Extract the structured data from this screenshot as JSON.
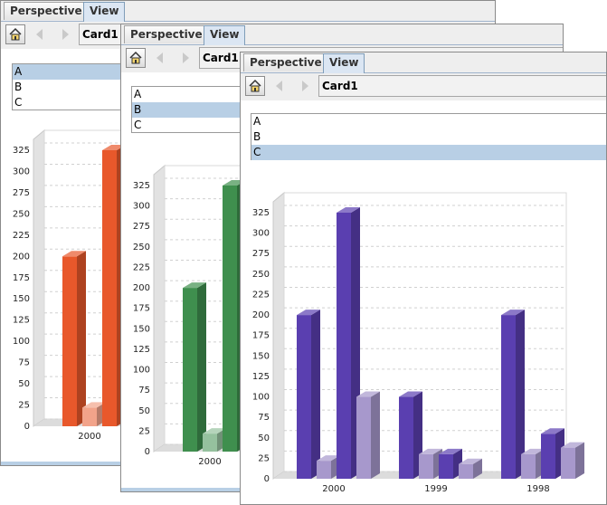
{
  "windows": [
    {
      "id": "w1",
      "tabs": [
        "Perspective",
        "View"
      ],
      "active_tab": 1,
      "toolbar": {
        "home_icon": "home-icon",
        "back_icon": "arrow-left-icon",
        "forward_icon": "arrow-right-icon"
      },
      "card_label": "Card1",
      "list": [
        {
          "label": "A",
          "selected": true
        },
        {
          "label": "B",
          "selected": false
        },
        {
          "label": "C",
          "selected": false
        }
      ],
      "chart_color": "#e8582b",
      "chart_data": {
        "type": "bar",
        "categories": [
          "2000"
        ],
        "series": [
          {
            "values": [
              200
            ]
          },
          {
            "values": [
              22
            ]
          },
          {
            "values": [
              325
            ]
          }
        ],
        "y_ticks": [
          0,
          25,
          50,
          75,
          100,
          125,
          150,
          175,
          200,
          225,
          250,
          275,
          300,
          325
        ],
        "ylim": [
          0,
          325
        ],
        "grid": true
      }
    },
    {
      "id": "w2",
      "tabs": [
        "Perspective",
        "View"
      ],
      "active_tab": 1,
      "toolbar": {
        "home_icon": "home-icon",
        "back_icon": "arrow-left-icon",
        "forward_icon": "arrow-right-icon"
      },
      "card_label": "Card1",
      "list": [
        {
          "label": "A",
          "selected": false
        },
        {
          "label": "B",
          "selected": true
        },
        {
          "label": "C",
          "selected": false
        }
      ],
      "chart_color": "#3f8f4e",
      "chart_data": {
        "type": "bar",
        "categories": [
          "2000"
        ],
        "series": [
          {
            "values": [
              200
            ]
          },
          {
            "values": [
              22
            ]
          },
          {
            "values": [
              325
            ]
          }
        ],
        "y_ticks": [
          0,
          25,
          50,
          75,
          100,
          125,
          150,
          175,
          200,
          225,
          250,
          275,
          300,
          325
        ],
        "ylim": [
          0,
          325
        ],
        "grid": true
      }
    },
    {
      "id": "w3",
      "tabs": [
        "Perspective",
        "View"
      ],
      "active_tab": 1,
      "toolbar": {
        "home_icon": "home-icon",
        "back_icon": "arrow-left-icon",
        "forward_icon": "arrow-right-icon"
      },
      "card_label": "Card1",
      "list": [
        {
          "label": "A",
          "selected": false
        },
        {
          "label": "B",
          "selected": false
        },
        {
          "label": "C",
          "selected": true
        }
      ],
      "chart_color": "#5a3fb0",
      "chart_color_light": "#a798cc",
      "chart_data": {
        "type": "bar",
        "categories": [
          "2000",
          "1999",
          "1998"
        ],
        "series": [
          {
            "values": [
              200,
              100,
              200
            ]
          },
          {
            "values": [
              22,
              30,
              30
            ]
          },
          {
            "values": [
              325,
              30,
              55
            ]
          },
          {
            "values": [
              100,
              18,
              38
            ]
          }
        ],
        "y_ticks": [
          0,
          25,
          50,
          75,
          100,
          125,
          150,
          175,
          200,
          225,
          250,
          275,
          300,
          325
        ],
        "ylim": [
          0,
          325
        ],
        "grid": true
      }
    }
  ]
}
